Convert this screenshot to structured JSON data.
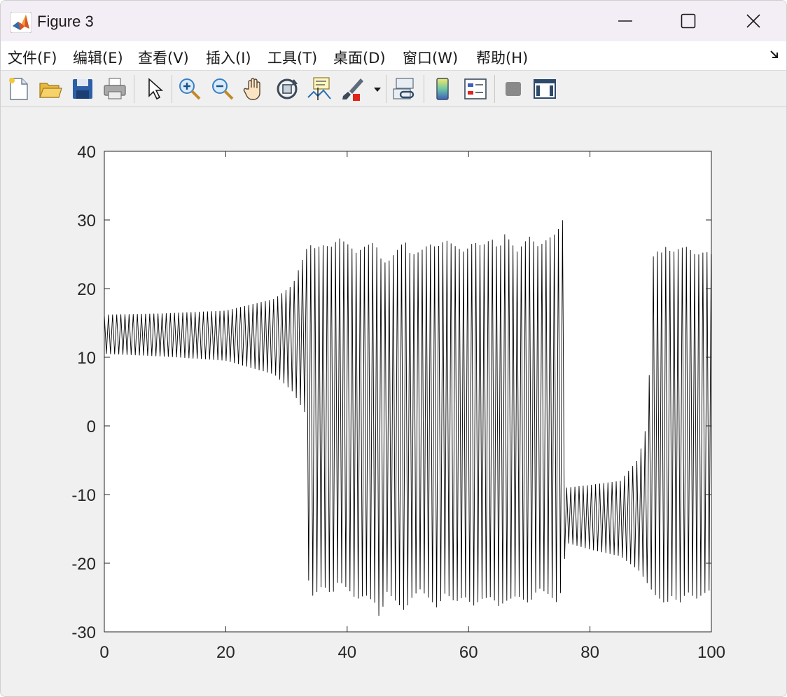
{
  "window": {
    "title": "Figure 3",
    "app_icon": "matlab-icon",
    "controls": [
      "minimize-icon",
      "maximize-icon",
      "close-icon"
    ]
  },
  "menu": [
    {
      "label": "文件(F)",
      "mnemonic": "F"
    },
    {
      "label": "编辑(E)",
      "mnemonic": "E"
    },
    {
      "label": "查看(V)",
      "mnemonic": "V"
    },
    {
      "label": "插入(I)",
      "mnemonic": "I"
    },
    {
      "label": "工具(T)",
      "mnemonic": "T"
    },
    {
      "label": "桌面(D)",
      "mnemonic": "D"
    },
    {
      "label": "窗口(W)",
      "mnemonic": "W"
    },
    {
      "label": "帮助(H)",
      "mnemonic": "H"
    }
  ],
  "toolbar": {
    "buttons": [
      "new-figure-icon",
      "open-file-icon",
      "save-icon",
      "print-icon",
      "edit-plot-arrow-icon",
      "zoom-in-icon",
      "zoom-out-icon",
      "pan-hand-icon",
      "rotate-3d-icon",
      "data-cursor-icon",
      "brush-icon",
      "brush-dropdown-icon",
      "link-plot-icon",
      "colorbar-icon",
      "legend-icon",
      "hide-plot-tools-icon",
      "show-plot-tools-icon"
    ]
  },
  "chart_data": {
    "type": "line",
    "title": "",
    "xlabel": "",
    "ylabel": "",
    "xlim": [
      0,
      100
    ],
    "ylim": [
      -30,
      40
    ],
    "xticks": [
      0,
      20,
      40,
      60,
      80,
      100
    ],
    "yticks": [
      -30,
      -20,
      -10,
      0,
      10,
      20,
      30,
      40
    ],
    "xtick_labels": [
      "0",
      "20",
      "40",
      "60",
      "80",
      "100"
    ],
    "ytick_labels": [
      "-30",
      "-20",
      "-10",
      "0",
      "10",
      "20",
      "30",
      "40"
    ],
    "grid": false,
    "line_color": "#000000",
    "series": [
      {
        "x": [
          0,
          10,
          20,
          28,
          31,
          33,
          33.7,
          34.4,
          36,
          37.5,
          38.6,
          40.2,
          41.5,
          43,
          44.6,
          45.4,
          46.5,
          47.8,
          49.5,
          50.5,
          52,
          53.5,
          54.8,
          56.2,
          57.8,
          59.3,
          60.8,
          62.2,
          63.8,
          65,
          66,
          68,
          70,
          71.5,
          73,
          74.5,
          75.5,
          76,
          80,
          85,
          88,
          89.5,
          90.5,
          91.5,
          92.5,
          93.5,
          94.8,
          96,
          97.5,
          99,
          100
        ],
        "y_upper": [
          16.2,
          16.4,
          16.8,
          18.5,
          20.5,
          25,
          26.7,
          25.8,
          26.3,
          26.1,
          27.4,
          26.4,
          25.2,
          26.2,
          26.8,
          24.5,
          23.6,
          25.1,
          27,
          24.8,
          25.4,
          26.5,
          26,
          27.1,
          26.2,
          25.3,
          26.8,
          26.2,
          27.3,
          25.6,
          28,
          25.4,
          27.6,
          26.1,
          27.2,
          28.1,
          30,
          -9,
          -8.6,
          -8,
          -4.8,
          0.8,
          26.2,
          24.9,
          26.1,
          25.2,
          25.9,
          26.1,
          24.8,
          25.4,
          25
        ],
        "y_lower": [
          10.5,
          10.1,
          9.5,
          7.5,
          5,
          2,
          -24,
          -24.8,
          -23.2,
          -24.6,
          -22.5,
          -23.8,
          -25.3,
          -24.6,
          -25.8,
          -28.2,
          -24.1,
          -25.3,
          -27,
          -25.2,
          -23.8,
          -25.1,
          -26.5,
          -24.3,
          -25.7,
          -24.8,
          -26.2,
          -25.2,
          -24.9,
          -26.3,
          -25.6,
          -24.7,
          -25.9,
          -23.6,
          -24.4,
          -25.7,
          -23.6,
          -17,
          -18,
          -19,
          -21,
          -23,
          -24.4,
          -25.2,
          -26,
          -24.8,
          -25.8,
          -24.1,
          -25.2,
          -24.3,
          -23.8
        ]
      }
    ]
  }
}
